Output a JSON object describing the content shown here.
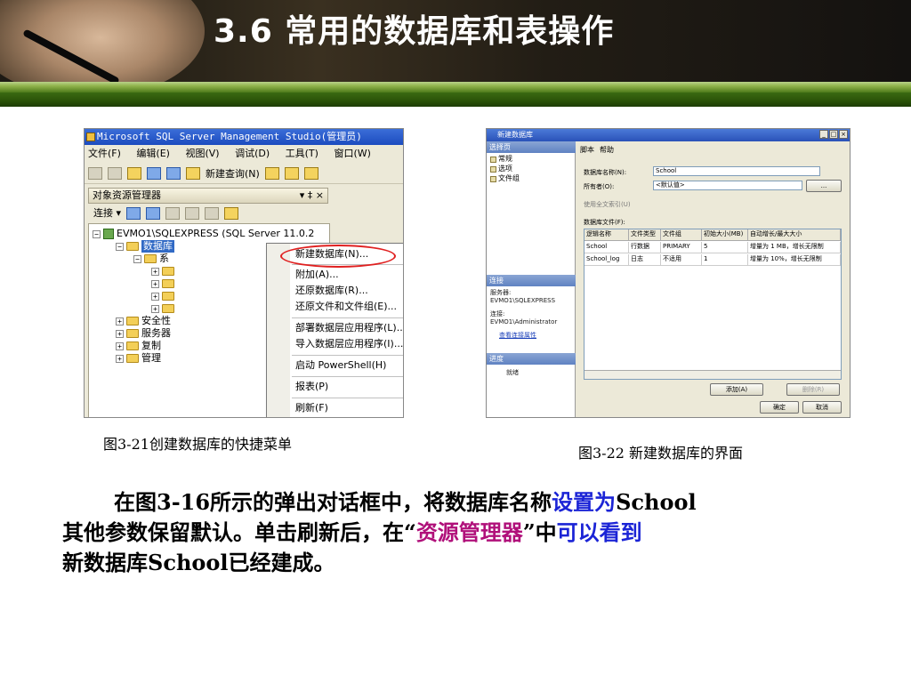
{
  "slide": {
    "title": "3.6 常用的数据库和表操作"
  },
  "figure1": {
    "window_title": "Microsoft SQL Server Management Studio(管理员)",
    "menus": [
      "文件(F)",
      "编辑(E)",
      "视图(V)",
      "调试(D)",
      "工具(T)",
      "窗口(W)"
    ],
    "new_query_label": "新建查询(N)",
    "explorer_title": "对象资源管理器",
    "explorer_controls": "▾ ‡ ×",
    "connect_label": "连接 ▾",
    "server_node": "EVMO1\\SQLEXPRESS (SQL Server 11.0.2",
    "db_node": "数据库",
    "sys_node": "系",
    "other_nodes": [
      "安全性",
      "服务器",
      "复制",
      "管理"
    ],
    "context_menu": [
      "新建数据库(N)...",
      "附加(A)...",
      "还原数据库(R)...",
      "还原文件和文件组(E)...",
      "部署数据层应用程序(L)...",
      "导入数据层应用程序(I)...",
      "启动 PowerShell(H)",
      "报表(P)",
      "刷新(F)"
    ],
    "caption": "图3-21创建数据库的快捷菜单"
  },
  "figure2": {
    "window_title": "新建数据库",
    "sections": {
      "select_page": "选择页",
      "connection": "连接",
      "progress": "进度"
    },
    "pages": [
      "常规",
      "选项",
      "文件组"
    ],
    "toolbar": {
      "script": "脚本",
      "help": "帮助"
    },
    "server_label": "服务器:",
    "server_value": "EVMO1\\SQLEXPRESS",
    "connection_label": "连接:",
    "connection_value": "EVMO1\\Administrator",
    "view_props_link": "查看连接属性",
    "progress_status": "就绪",
    "db_name_label": "数据库名称(N):",
    "db_name_value": "School",
    "owner_label": "所有者(O):",
    "owner_value": "<默认值>",
    "fulltext_label": "使用全文索引(U)",
    "files_label": "数据库文件(F):",
    "grid_headers": [
      "逻辑名称",
      "文件类型",
      "文件组",
      "初始大小(MB)",
      "自动增长/最大大小"
    ],
    "grid_rows": [
      [
        "School",
        "行数据",
        "PRIMARY",
        "5",
        "增量为 1 MB，增长无限制"
      ],
      [
        "School_log",
        "日志",
        "不适用",
        "1",
        "增量为 10%，增长无限制"
      ]
    ],
    "add_button": "添加(A)",
    "remove_button": "删除(R)",
    "ok_button": "确定",
    "cancel_button": "取消",
    "browse_button": "...",
    "caption": "图3-22  新建数据库的界面"
  },
  "paragraph": {
    "p1": "在图3-16所示的弹出对话框中，将数据库名称",
    "p1_hl": "设置为",
    "p1_end": "School",
    "p2": "其他参数保留默认。单击刷新后，在“",
    "p2_hl": "资源管理器",
    "p2_mid": "”中",
    "p2_hl2": "可以看到",
    "p3": "新数据库School已经建成。"
  },
  "colors": {
    "highlight_blue": "#1b24d6",
    "highlight_magenta": "#b0107a",
    "ring_red": "#e02020",
    "banner_green": "#4e7a1a"
  }
}
